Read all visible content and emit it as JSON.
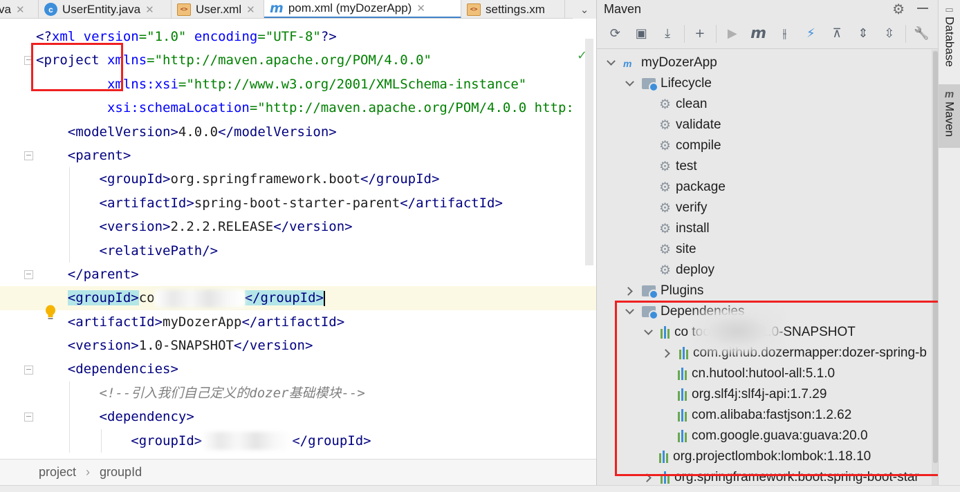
{
  "tabs": [
    {
      "label": "va",
      "icon": "none",
      "active": false
    },
    {
      "label": "UserEntity.java",
      "icon": "java-class-icon",
      "active": false
    },
    {
      "label": "User.xml",
      "icon": "xml-file-icon",
      "active": false
    },
    {
      "label": "pom.xml (myDozerApp)",
      "icon": "maven-file-icon",
      "active": true
    },
    {
      "label": "settings.xm",
      "icon": "xml-file-icon",
      "active": false
    }
  ],
  "editor": {
    "lines": [
      {
        "indent": 0,
        "html": "<span class=\"t\">&lt;?</span><span class=\"a\">xml version</span><span class=\"s\">=\"1.0\"</span> <span class=\"a\">encoding</span><span class=\"s\">=\"UTF-8\"</span><span class=\"t\">?&gt;</span>"
      },
      {
        "indent": 0,
        "html": "<span class=\"t\">&lt;project</span> <span class=\"a\">xmlns</span><span class=\"s\">=\"http://maven.apache.org/POM/4.0.0\"</span>"
      },
      {
        "indent": 0,
        "html": "         <span class=\"a\">xmlns:xsi</span><span class=\"s\">=\"http://www.w3.org/2001/XMLSchema-instance\"</span>"
      },
      {
        "indent": 0,
        "html": "         <span class=\"a\">xsi:schemaLocation</span><span class=\"s\">=\"http://maven.apache.org/POM/4.0.0 http:</span>"
      },
      {
        "indent": 1,
        "html": "<span class=\"t\">&lt;modelVersion&gt;</span>4.0.0<span class=\"t\">&lt;/modelVersion&gt;</span>"
      },
      {
        "indent": 1,
        "html": "<span class=\"t\">&lt;parent&gt;</span>"
      },
      {
        "indent": 2,
        "html": "<span class=\"t\">&lt;groupId&gt;</span>org.springframework.boot<span class=\"t\">&lt;/groupId&gt;</span>"
      },
      {
        "indent": 2,
        "html": "<span class=\"t\">&lt;artifactId&gt;</span>spring-boot-starter-parent<span class=\"t\">&lt;/artifactId&gt;</span>"
      },
      {
        "indent": 2,
        "html": "<span class=\"t\">&lt;version&gt;</span>2.2.2.RELEASE<span class=\"t\">&lt;/version&gt;</span>"
      },
      {
        "indent": 2,
        "html": "<span class=\"t\">&lt;relativePath/&gt;</span>"
      },
      {
        "indent": 1,
        "html": "<span class=\"t\">&lt;/parent&gt;</span>"
      },
      {
        "indent": 1,
        "html": "<span class=\"t hl\">&lt;groupId&gt;</span>co<span class=\"blur\"></span><span class=\"t hl\">&lt;/groupId&gt;</span><span class=\"caret\"></span>",
        "current": true
      },
      {
        "indent": 1,
        "html": "<span class=\"t\">&lt;artifactId&gt;</span>myDozerApp<span class=\"t\">&lt;/artifactId&gt;</span>"
      },
      {
        "indent": 1,
        "html": "<span class=\"t\">&lt;version&gt;</span>1.0-SNAPSHOT<span class=\"t\">&lt;/version&gt;</span>"
      },
      {
        "indent": 1,
        "html": "<span class=\"t\">&lt;dependencies&gt;</span>"
      },
      {
        "indent": 2,
        "html": "<span class=\"c\">&lt;!--引入我们自己定义的dozer基础模块--&gt;</span>"
      },
      {
        "indent": 2,
        "html": "<span class=\"t\">&lt;dependency&gt;</span>"
      },
      {
        "indent": 3,
        "html": "<span class=\"t\">&lt;groupId&gt;</span><span class=\"blur\"></span><span class=\"t\">&lt;/groupId&gt;</span>"
      }
    ]
  },
  "breadcrumb": [
    "project",
    "groupId"
  ],
  "maven": {
    "title": "Maven",
    "toolbar": [
      "reload-icon",
      "generate-sources-icon",
      "download-icon",
      "add-icon",
      "run-icon",
      "maven-goal-icon",
      "toggle-offline-icon",
      "skip-tests-icon",
      "show-dependencies-icon",
      "expand-all-icon",
      "collapse-all-icon",
      "settings-wrench-icon"
    ],
    "tree": [
      {
        "level": 0,
        "arrow": "down",
        "icon": "project",
        "label": "myDozerApp"
      },
      {
        "level": 1,
        "arrow": "down",
        "icon": "folder",
        "label": "Lifecycle"
      },
      {
        "level": 2,
        "arrow": "none",
        "icon": "gear",
        "label": "clean"
      },
      {
        "level": 2,
        "arrow": "none",
        "icon": "gear",
        "label": "validate"
      },
      {
        "level": 2,
        "arrow": "none",
        "icon": "gear",
        "label": "compile"
      },
      {
        "level": 2,
        "arrow": "none",
        "icon": "gear",
        "label": "test"
      },
      {
        "level": 2,
        "arrow": "none",
        "icon": "gear",
        "label": "package"
      },
      {
        "level": 2,
        "arrow": "none",
        "icon": "gear",
        "label": "verify"
      },
      {
        "level": 2,
        "arrow": "none",
        "icon": "gear",
        "label": "install"
      },
      {
        "level": 2,
        "arrow": "none",
        "icon": "gear",
        "label": "site"
      },
      {
        "level": 2,
        "arrow": "none",
        "icon": "gear",
        "label": "deploy"
      },
      {
        "level": 1,
        "arrow": "right",
        "icon": "folder",
        "label": "Plugins"
      },
      {
        "level": 1,
        "arrow": "down",
        "icon": "folder",
        "label": "Dependencies"
      },
      {
        "level": 2,
        "arrow": "down",
        "icon": "lib",
        "label": "co          tools-dozer:1.0-SNAPSHOT"
      },
      {
        "level": 3,
        "arrow": "right",
        "icon": "lib",
        "label": "com.github.dozermapper:dozer-spring-b"
      },
      {
        "level": 3,
        "arrow": "none",
        "icon": "lib",
        "label": "cn.hutool:hutool-all:5.1.0"
      },
      {
        "level": 3,
        "arrow": "none",
        "icon": "lib",
        "label": "org.slf4j:slf4j-api:1.7.29"
      },
      {
        "level": 3,
        "arrow": "none",
        "icon": "lib",
        "label": "com.alibaba:fastjson:1.2.62"
      },
      {
        "level": 3,
        "arrow": "none",
        "icon": "lib",
        "label": "com.google.guava:guava:20.0"
      },
      {
        "level": 2,
        "arrow": "none",
        "icon": "lib",
        "label": "org.projectlombok:lombok:1.18.10"
      },
      {
        "level": 2,
        "arrow": "right",
        "icon": "lib",
        "label": "org.springframework.boot:spring-boot-star"
      }
    ]
  },
  "side_tabs": [
    "Database",
    "Maven"
  ],
  "colors": {
    "accent": "#4083c9",
    "annotation_red": "#f02020",
    "xml_tag": "#000080",
    "xml_attr": "#0000ff",
    "xml_string": "#008000"
  }
}
